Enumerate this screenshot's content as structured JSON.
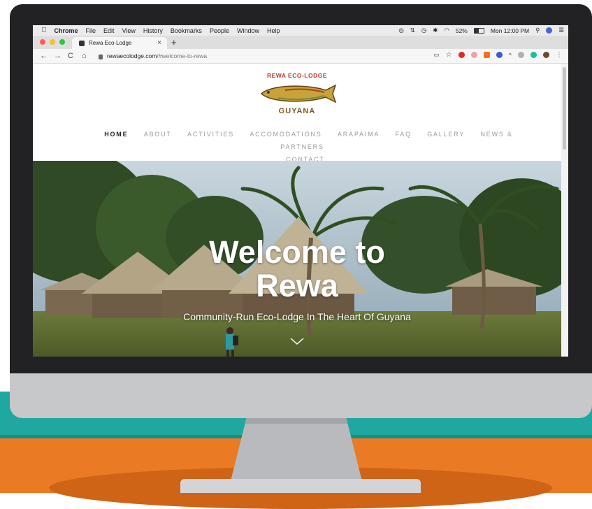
{
  "menubar": {
    "app_name": "Chrome",
    "items": [
      "File",
      "Edit",
      "View",
      "History",
      "Bookmarks",
      "People",
      "Window",
      "Help"
    ],
    "battery": "52%",
    "clock": "Mon 12:00 PM"
  },
  "tab": {
    "title": "Rewa Eco-Lodge",
    "close_label": "×",
    "new_tab_label": "+"
  },
  "address_bar": {
    "back_label": "←",
    "forward_label": "→",
    "reload_label": "C",
    "home_label": "⌂",
    "url_host": "rewaecolodge.com",
    "url_path": "/#welcome-to-rewa"
  },
  "logo": {
    "top_text": "REWA ECO-LODGE",
    "bottom_text": "GUYANA"
  },
  "nav": {
    "items": [
      "HOME",
      "ABOUT",
      "ACTIVITIES",
      "ACCOMODATIONS",
      "ARAPAIMA",
      "FAQ",
      "GALLERY",
      "NEWS & PARTNERS"
    ],
    "second_row": [
      "CONTACT"
    ]
  },
  "hero": {
    "title_line1": "Welcome to",
    "title_line2": "Rewa",
    "subtitle": "Community-Run Eco-Lodge In The Heart Of Guyana"
  },
  "colors": {
    "teal": "#1ea89f",
    "orange": "#ea7a24",
    "bezel": "#222224",
    "chin": "#c7c8ca"
  }
}
